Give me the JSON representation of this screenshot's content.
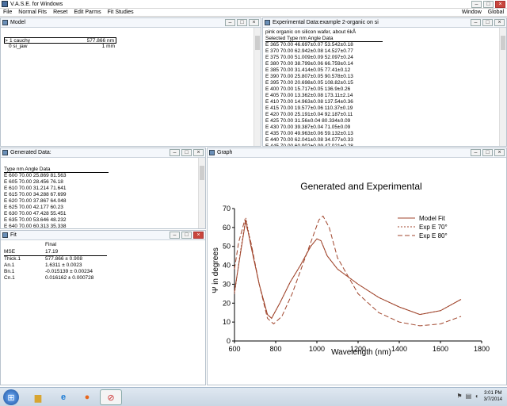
{
  "app": {
    "title": "V.A.S.E. for Windows",
    "menu_left": [
      "File",
      "Normal Fits",
      "Reset",
      "Edit Parms",
      "Fit Studies"
    ],
    "menu_right": [
      "Window",
      "Global"
    ]
  },
  "model_panel": {
    "title": "Model",
    "layers": [
      {
        "marker": ">",
        "name": "1 cauchy",
        "value": "577.866 nm"
      },
      {
        "marker": "",
        "name": "0 si_jaw",
        "value": "1 mm"
      }
    ]
  },
  "exp_panel": {
    "title": "Experimental Data:example 2-organic on si",
    "subtitle": "pink organic on silicon wafer, about 6kÅ",
    "header": "Selected Type  nm  Angle  Data",
    "rows": [
      "E  365  70.00  46.697±0.07  53.542±0.18",
      "E  370  70.00  62.942±0.08  14.527±0.77",
      "E  375  70.00  51.009±0.09  52.097±0.24",
      "E  380  70.00  38.799±0.06  66.759±0.14",
      "E  385  70.00  31.414±0.05  77.41±0.12",
      "E  390  70.00  25.807±0.05  90.578±0.13",
      "E  395  70.00  20.698±0.05  108.82±0.15",
      "E  400  70.00  15.717±0.05  136.9±0.26",
      "E  405  70.00  13.362±0.08  173.11±2.14",
      "E  410  70.00  14.963±0.08  137.54±0.36",
      "E  415  70.00  19.577±0.06  110.37±0.19",
      "E  420  70.00  25.191±0.04  92.187±0.11",
      "E  425  70.00  31.56±0.04  80.334±0.09",
      "E  430  70.00  39.387±0.04  71.05±0.09",
      "E  435  70.00  49.963±0.06  59.132±0.13",
      "E  440  70.00  62.041±0.08  34.077±0.33",
      "E  445  70.00  60.902±0.09  47.021±0.28"
    ]
  },
  "gen_panel": {
    "title": "Generated Data:",
    "header": "Type  nm  Angle  Data",
    "rows": [
      "E  600  70.00  25.869  81.563",
      "E  605  70.00  28.456  76.18",
      "E  610  70.00  31.214  71.641",
      "E  615  70.00  34.288  67.699",
      "E  620  70.00  37.867  64.048",
      "E  625  70.00  42.177  60.23",
      "E  630  70.00  47.428  55.451",
      "E  635  70.00  53.646  48.232",
      "E  640  70.00  60.313  35.338"
    ]
  },
  "fit_panel": {
    "title": "Fit",
    "col_header": "Final",
    "mse_label": "MSE",
    "mse_value": "17.19",
    "params": [
      {
        "name": "Thick.1",
        "value": "577.866 ± 0.908"
      },
      {
        "name": "An.1",
        "value": "1.6311 ± 0.0023"
      },
      {
        "name": "Bn.1",
        "value": "-0.015139 ± 0.00234"
      },
      {
        "name": "Cn.1",
        "value": "0.016162 ± 0.000728"
      }
    ]
  },
  "graph_panel": {
    "title": "Graph"
  },
  "taskbar": {
    "time": "3:01 PM",
    "date": "3/7/2014"
  },
  "chart_data": {
    "type": "line",
    "title": "Generated and Experimental",
    "xlabel": "Wavelength (nm)",
    "ylabel": "Ψ in degrees",
    "xlim": [
      600,
      1800
    ],
    "ylim": [
      0,
      70
    ],
    "xticks": [
      "600",
      "800",
      "1000",
      "1200",
      "1400",
      "1600",
      "1800"
    ],
    "yticks": [
      "0",
      "10",
      "20",
      "30",
      "40",
      "50",
      "60",
      "70"
    ],
    "legend_position": "right",
    "series": [
      {
        "name": "Model Fit",
        "color": "#a0452c",
        "dash": "",
        "x": [
          600,
          630,
          655,
          680,
          720,
          760,
          780,
          820,
          870,
          920,
          970,
          1000,
          1020,
          1050,
          1100,
          1200,
          1300,
          1400,
          1500,
          1600,
          1700
        ],
        "y": [
          26,
          47,
          64,
          50,
          30,
          14,
          12,
          20,
          31,
          40,
          50,
          54,
          53,
          45,
          38,
          30,
          23,
          18,
          14,
          16,
          22
        ]
      },
      {
        "name": "Exp E 70°",
        "color": "#a0452c",
        "dash": "2,2",
        "x": [
          600,
          630,
          655,
          680,
          720,
          760,
          780,
          820,
          870,
          920,
          970,
          1000,
          1020,
          1050,
          1100,
          1200,
          1300,
          1400,
          1500,
          1600,
          1700
        ],
        "y": [
          25,
          48,
          65,
          51,
          30,
          14,
          12,
          20,
          31,
          40,
          50,
          54,
          53,
          45,
          38,
          30,
          23,
          18,
          14,
          16,
          22
        ]
      },
      {
        "name": "Exp E 80°",
        "color": "#a0452c",
        "dash": "6,3",
        "x": [
          600,
          620,
          650,
          680,
          720,
          760,
          790,
          830,
          880,
          930,
          980,
          1010,
          1030,
          1060,
          1100,
          1200,
          1300,
          1400,
          1500,
          1600,
          1700
        ],
        "y": [
          38,
          52,
          64,
          52,
          30,
          12,
          9,
          13,
          25,
          40,
          55,
          64,
          66,
          60,
          44,
          25,
          15,
          10,
          8,
          9,
          13
        ]
      }
    ]
  }
}
